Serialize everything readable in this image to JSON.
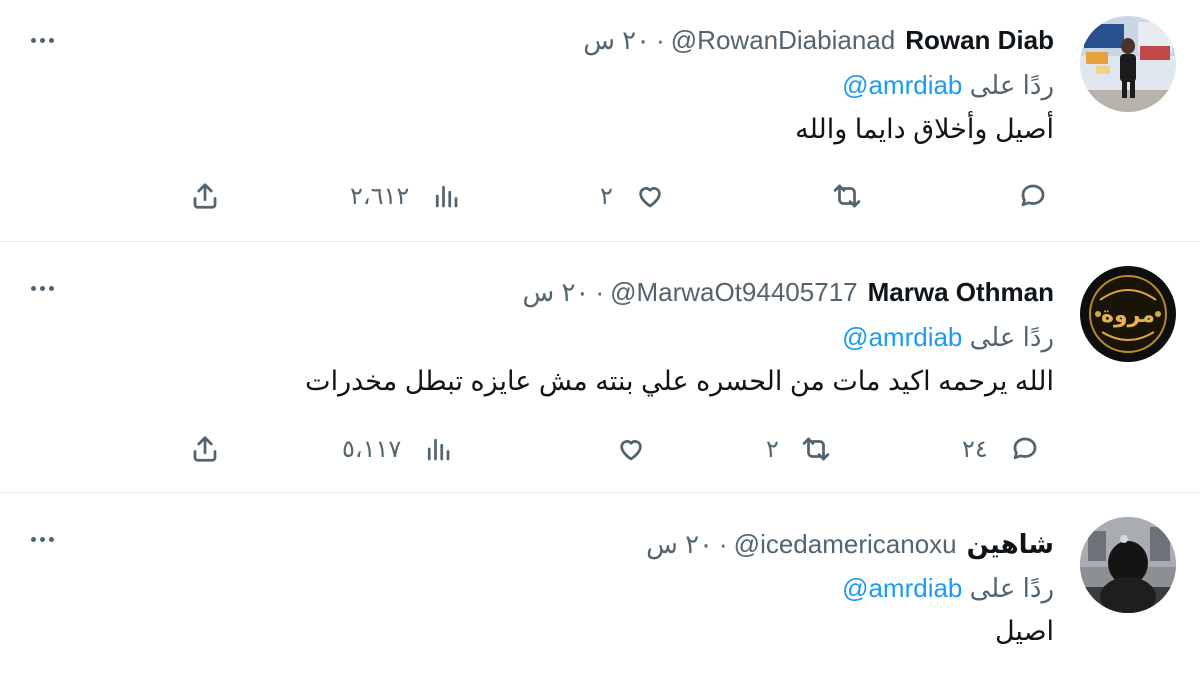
{
  "tweets": [
    {
      "name": "Rowan Diab",
      "handle": "@RowanDiabianad",
      "separator": "·",
      "time": "٢٠ س",
      "reply_prefix": "ردًا على",
      "reply_mention": "@amrdiab",
      "text": "أصيل وأخلاق دايما والله",
      "counts": {
        "replies": "",
        "retweets": "",
        "likes": "٢",
        "views": "٢،٦١٢"
      }
    },
    {
      "name": "Marwa Othman",
      "handle": "@MarwaOt94405717",
      "separator": "·",
      "time": "٢٠ س",
      "reply_prefix": "ردًا على",
      "reply_mention": "@amrdiab",
      "text": "الله يرحمه اكيد مات من الحسره علي بنته مش عايزه تبطل مخدرات",
      "counts": {
        "replies": "٢٤",
        "retweets": "٢",
        "likes": "",
        "views": "٥،١١٧"
      }
    },
    {
      "name": "شاهين",
      "handle": "@icedamericanoxu",
      "separator": "·",
      "time": "٢٠ س",
      "reply_prefix": "ردًا على",
      "reply_mention": "@amrdiab",
      "text": "اصيل",
      "counts": {}
    }
  ],
  "icons": {
    "reply": "reply-icon",
    "retweet": "retweet-icon",
    "like": "like-icon",
    "views": "views-icon",
    "share": "share-icon",
    "more": "more-icon"
  },
  "colors": {
    "text": "#0f1419",
    "muted": "#536471",
    "link": "#1d9bf0",
    "border": "#e6ecf0"
  }
}
